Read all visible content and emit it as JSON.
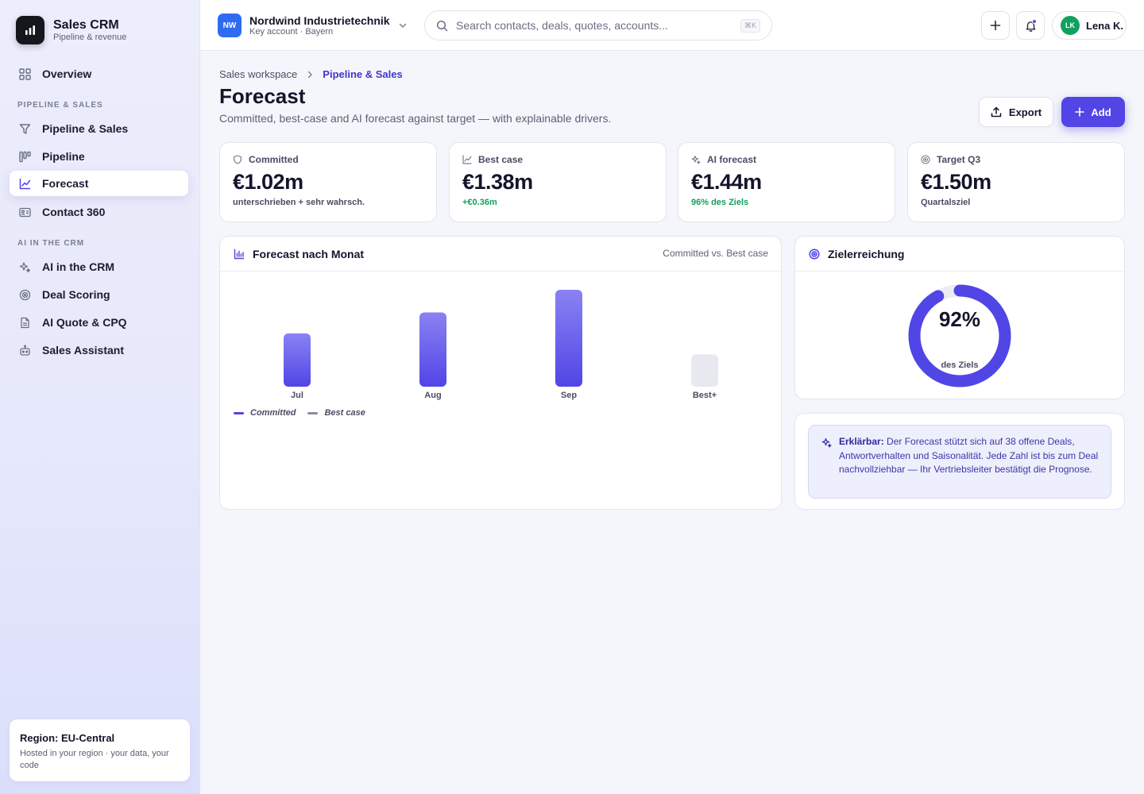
{
  "brand": {
    "title": "Sales CRM",
    "subtitle": "Pipeline & revenue"
  },
  "sidebar": {
    "overview": "Overview",
    "section_pipeline": "PIPELINE & SALES",
    "items_pipeline": [
      "Pipeline & Sales",
      "Pipeline",
      "Forecast",
      "Contact 360"
    ],
    "section_ai": "AI IN THE CRM",
    "items_ai": [
      "AI in the CRM",
      "Deal Scoring",
      "AI Quote & CPQ",
      "Sales Assistant"
    ],
    "active": "Forecast",
    "region_title": "Region: EU-Central",
    "region_sub": "Hosted in your region · your data, your code"
  },
  "topbar": {
    "account_initials": "NW",
    "account_name": "Nordwind Industrietechnik",
    "account_sub": "Key account · Bayern",
    "search_placeholder": "Search contacts, deals, quotes, accounts...",
    "search_shortcut": "⌘K",
    "user_initials": "LK",
    "user_name": "Lena K."
  },
  "breadcrumb": {
    "root": "Sales workspace",
    "current": "Pipeline & Sales"
  },
  "page": {
    "title": "Forecast",
    "subtitle": "Committed, best-case and AI forecast against target — with explainable drivers.",
    "export_label": "Export",
    "add_label": "Add"
  },
  "kpis": [
    {
      "label": "Committed",
      "value": "€1.02m",
      "note": "unterschrieben + sehr wahrsch.",
      "note_color": "#4a4c63",
      "icon": "shield-icon"
    },
    {
      "label": "Best case",
      "value": "€1.38m",
      "note": "+€0.36m",
      "note_color": "#12a05c",
      "icon": "trend-up-icon"
    },
    {
      "label": "AI forecast",
      "value": "€1.44m",
      "note": "96% des Ziels",
      "note_color": "#12a05c",
      "icon": "sparkle-icon"
    },
    {
      "label": "Target Q3",
      "value": "€1.50m",
      "note": "Quartalsziel",
      "note_color": "#4a4c63",
      "icon": "target-icon"
    }
  ],
  "forecast_card": {
    "title": "Forecast nach Monat",
    "hint": "Committed vs. Best case"
  },
  "chart_data": {
    "type": "bar",
    "categories": [
      "Jul",
      "Aug",
      "Sep",
      "Best+"
    ],
    "series": [
      {
        "name": "Committed",
        "values": [
          0.33,
          0.46,
          0.6,
          null
        ],
        "color": "#5145e6"
      },
      {
        "name": "Best case",
        "values": [
          null,
          null,
          null,
          0.2
        ],
        "color": "#8a8c9e"
      }
    ],
    "ylim": [
      0,
      0.6
    ],
    "legend": "bottom-left"
  },
  "goal_card": {
    "title": "Zielerreichung",
    "percent": 92,
    "percent_label": "92%",
    "sub": "des Ziels"
  },
  "explain": {
    "lead": "Erklärbar:",
    "text": "Der Forecast stützt sich auf 38 offene Deals, Antwortverhalten und Saisonalität. Jede Zahl ist bis zum Deal nachvollziehbar — Ihr Vertriebsleiter bestätigt die Prognose."
  },
  "colors": {
    "accent": "#5145e6",
    "positive": "#12a05c",
    "account_badge": "#2f6bf0"
  }
}
